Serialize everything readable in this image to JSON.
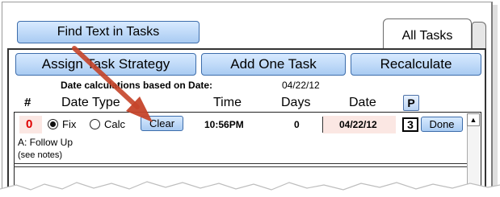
{
  "toolbar": {
    "find_button": "Find Text in Tasks",
    "tab_label": "All Tasks"
  },
  "actions": {
    "assign_strategy": "Assign Task Strategy",
    "add_task": "Add One Task",
    "recalculate": "Recalculate"
  },
  "info": {
    "date_basis_label": "Date calculations based on Date:",
    "date_basis_value": "04/22/12"
  },
  "columns": {
    "num": "#",
    "date_type": "Date Type",
    "time": "Time",
    "days": "Days",
    "date": "Date",
    "priority": "P"
  },
  "task": {
    "number": "0",
    "fix_label": "Fix",
    "calc_label": "Calc",
    "selected": "Fix",
    "clear_button": "Clear",
    "time": "10:56PM",
    "days": "0",
    "date": "04/22/12",
    "priority": "3",
    "done_button": "Done",
    "title": "A: Follow Up",
    "notes": "(see notes)"
  },
  "colors": {
    "button_blue": "#a9cbf2",
    "highlight_red": "#fbe7e3",
    "number_red": "#e00000",
    "arrow": "#c5442a"
  }
}
